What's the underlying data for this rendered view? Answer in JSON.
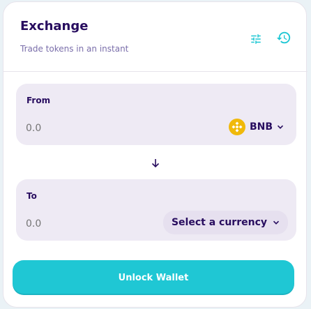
{
  "header": {
    "title": "Exchange",
    "subtitle": "Trade tokens in an instant"
  },
  "from": {
    "label": "From",
    "amount_placeholder": "0.0",
    "token": "BNB",
    "token_icon": "bnb-icon"
  },
  "to": {
    "label": "To",
    "amount_placeholder": "0.0",
    "select_label": "Select a currency"
  },
  "actions": {
    "unlock_label": "Unlock Wallet"
  },
  "colors": {
    "primary": "#1fc7d4",
    "text": "#280d5f",
    "text_subtle": "#7a6eaa",
    "input_bg": "#eeeaf4",
    "bnb": "#f0b90b"
  }
}
